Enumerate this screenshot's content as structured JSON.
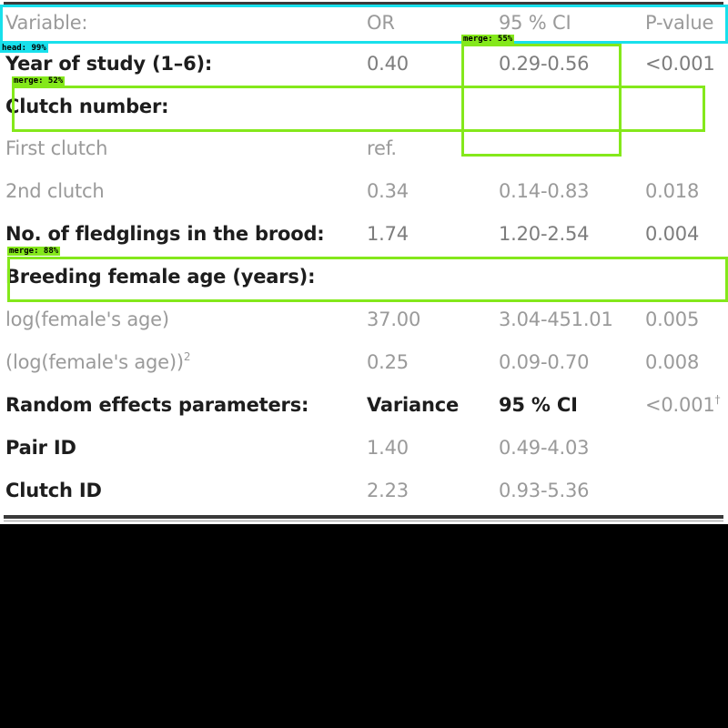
{
  "table": {
    "header": {
      "variable": "Variable:",
      "or": "OR",
      "ci": "95 % CI",
      "pvalue": "P-value"
    },
    "rows": [
      {
        "label": "Year of study (1–6):",
        "or": "0.40",
        "ci": "0.29-0.56",
        "p": "<0.001"
      },
      {
        "label": "Clutch number:",
        "or": "",
        "ci": "",
        "p": ""
      },
      {
        "label": "First clutch",
        "or": "ref.",
        "ci": "",
        "p": ""
      },
      {
        "label": "2nd clutch",
        "or": "0.34",
        "ci": "0.14-0.83",
        "p": "0.018"
      },
      {
        "label": "No. of fledglings in the brood:",
        "or": "1.74",
        "ci": "1.20-2.54",
        "p": "0.004"
      },
      {
        "label": "Breeding female age (years):",
        "or": "",
        "ci": "",
        "p": ""
      },
      {
        "label": "log(female's age)",
        "or": "37.00",
        "ci": "3.04-451.01",
        "p": "0.005"
      },
      {
        "label": "(log(female's age))",
        "label_sup": "2",
        "or": "0.25",
        "ci": "0.09-0.70",
        "p": "0.008"
      },
      {
        "label": "Random effects parameters:",
        "or": "Variance",
        "ci": "95 % CI",
        "p": "<0.001",
        "p_sup": "†"
      },
      {
        "label": "Pair ID",
        "or": "1.40",
        "ci": "0.49-4.03",
        "p": ""
      },
      {
        "label": "Clutch ID",
        "or": "2.23",
        "ci": "0.93-5.36",
        "p": ""
      }
    ]
  },
  "detections": [
    {
      "label": "head: 99%",
      "color": "#18e0ec"
    },
    {
      "label": "merge: 55%",
      "color": "#84e81b"
    },
    {
      "label": "merge: 52%",
      "color": "#84e81b"
    },
    {
      "label": "merge: 88%",
      "color": "#84e81b"
    }
  ]
}
